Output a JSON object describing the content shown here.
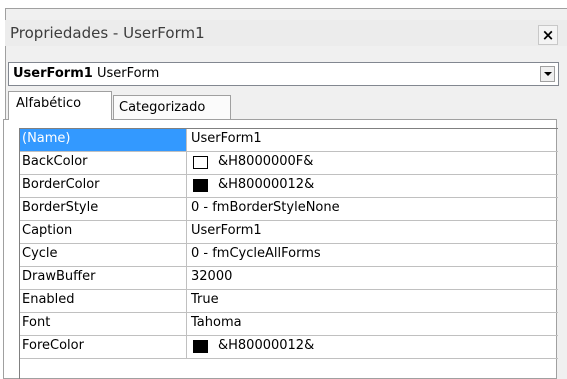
{
  "window": {
    "title": "Propriedades - UserForm1",
    "close_glyph": "×"
  },
  "object_selector": {
    "name": "UserForm1",
    "type": "UserForm"
  },
  "tabs": [
    {
      "label": "Alfabético",
      "active": true
    },
    {
      "label": "Categorizado",
      "active": false
    }
  ],
  "properties": [
    {
      "name": "(Name)",
      "value": "UserForm1",
      "selected": true
    },
    {
      "name": "BackColor",
      "value": "&H8000000F&",
      "swatch": "#ffffff"
    },
    {
      "name": "BorderColor",
      "value": "&H80000012&",
      "swatch": "#000000"
    },
    {
      "name": "BorderStyle",
      "value": "0 - fmBorderStyleNone"
    },
    {
      "name": "Caption",
      "value": "UserForm1"
    },
    {
      "name": "Cycle",
      "value": "0 - fmCycleAllForms"
    },
    {
      "name": "DrawBuffer",
      "value": "32000"
    },
    {
      "name": "Enabled",
      "value": "True"
    },
    {
      "name": "Font",
      "value": "Tahoma"
    },
    {
      "name": "ForeColor",
      "value": "&H80000012&",
      "swatch": "#000000"
    }
  ]
}
